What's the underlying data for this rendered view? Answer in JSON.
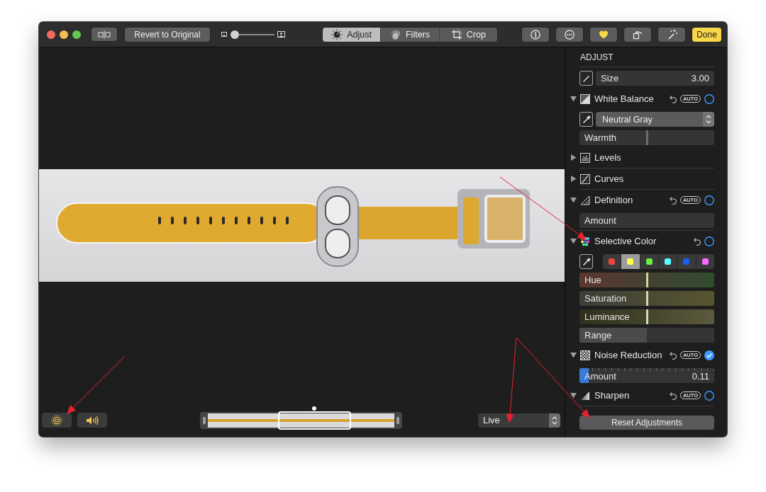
{
  "toolbar": {
    "revert_button": "Revert to Original",
    "zoom_slider": {
      "level": 0
    },
    "tabs": [
      {
        "kind": "adjust",
        "label": "Adjust",
        "selected": true
      },
      {
        "kind": "filters",
        "label": "Filters",
        "selected": false
      },
      {
        "kind": "crop",
        "label": "Crop",
        "selected": false
      }
    ],
    "favorite": true,
    "done_button": "Done"
  },
  "viewer": {
    "live_photo_on": true,
    "sound_on": true,
    "effect_popup": "Live"
  },
  "sidebar": {
    "title": "ADJUST",
    "size_field": {
      "label": "Size",
      "value": "3.00"
    },
    "sections": [
      {
        "kind": "balance",
        "label": "White Balance",
        "expanded": true,
        "undo": true,
        "auto": "AUTO",
        "on": false,
        "controls": [
          {
            "kind": "popup",
            "value": "Neutral Gray"
          },
          {
            "kind": "slider",
            "label": "Warmth",
            "level": 0.5
          }
        ]
      },
      {
        "kind": "levels",
        "label": "Levels",
        "expanded": false,
        "separator": true
      },
      {
        "kind": "curves",
        "label": "Curves",
        "expanded": false,
        "separator": true
      },
      {
        "kind": "definition",
        "label": "Definition",
        "expanded": true,
        "undo": true,
        "auto": "AUTO",
        "on": false,
        "separator": true,
        "controls": [
          {
            "kind": "amount",
            "label": "Amount"
          }
        ]
      },
      {
        "kind": "color",
        "label": "Selective Color",
        "expanded": true,
        "undo": true,
        "on": false,
        "controls": [
          {
            "kind": "swatches",
            "swatches": [
              {
                "color": "#e8463a",
                "selected": false
              },
              {
                "color": "#ffff4d",
                "selected": true
              },
              {
                "color": "#66ee44",
                "selected": false
              },
              {
                "color": "#55ffff",
                "selected": false
              },
              {
                "color": "#1a5cf0",
                "selected": false
              },
              {
                "color": "#ff66ff",
                "selected": false
              }
            ]
          },
          {
            "kind": "hue",
            "label": "Hue",
            "level": 0.5
          },
          {
            "kind": "saturation",
            "label": "Saturation",
            "level": 0.5
          },
          {
            "kind": "luminance",
            "label": "Luminance",
            "level": 0.5
          },
          {
            "kind": "amount",
            "label": "Range",
            "level": 0.5
          }
        ]
      },
      {
        "kind": "noise",
        "label": "Noise Reduction",
        "expanded": true,
        "undo": true,
        "auto": "AUTO",
        "on": true,
        "controls": [
          {
            "kind": "amount",
            "label": "Amount",
            "level": 0.07,
            "value": "0.11"
          }
        ]
      },
      {
        "kind": "sharpen",
        "label": "Sharpen",
        "expanded": true,
        "undo": true,
        "auto": "AUTO",
        "on": false,
        "separator": true
      }
    ],
    "reset_button": "Reset Adjustments"
  },
  "annotations": [
    {
      "kind": "arrow"
    },
    {
      "kind": "arrow"
    },
    {
      "kind": "arrow"
    },
    {
      "kind": "arrow"
    }
  ]
}
